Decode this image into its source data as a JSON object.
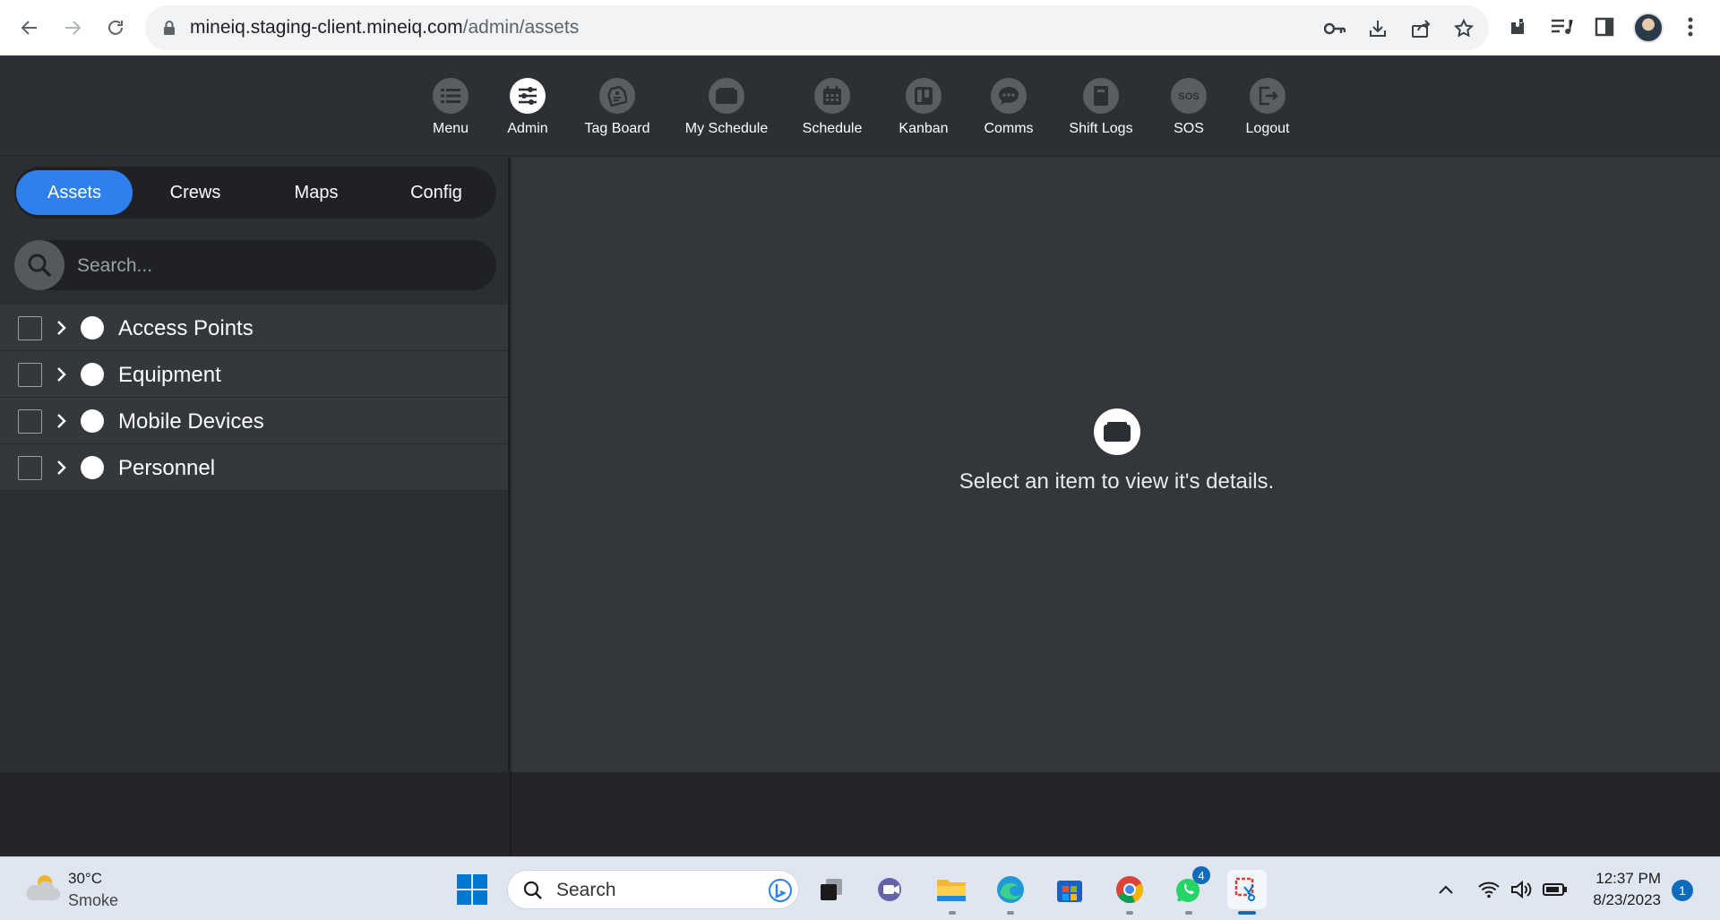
{
  "browser": {
    "url_host": "mineiq.staging-client.mineiq.com",
    "url_path": "/admin/assets"
  },
  "topnav": {
    "items": [
      {
        "label": "Menu",
        "icon": "list-icon"
      },
      {
        "label": "Admin",
        "icon": "sliders-icon",
        "active": true
      },
      {
        "label": "Tag Board",
        "icon": "tag-icon"
      },
      {
        "label": "My Schedule",
        "icon": "folder-icon"
      },
      {
        "label": "Schedule",
        "icon": "calendar-icon"
      },
      {
        "label": "Kanban",
        "icon": "kanban-icon"
      },
      {
        "label": "Comms",
        "icon": "chat-icon"
      },
      {
        "label": "Shift Logs",
        "icon": "book-icon"
      },
      {
        "label": "SOS",
        "icon": "sos-icon"
      },
      {
        "label": "Logout",
        "icon": "logout-icon"
      }
    ]
  },
  "sidebar": {
    "tabs": [
      {
        "label": "Assets",
        "active": true
      },
      {
        "label": "Crews"
      },
      {
        "label": "Maps"
      },
      {
        "label": "Config"
      }
    ],
    "search_placeholder": "Search...",
    "tree": [
      {
        "label": "Access Points"
      },
      {
        "label": "Equipment"
      },
      {
        "label": "Mobile Devices"
      },
      {
        "label": "Personnel"
      }
    ]
  },
  "main": {
    "empty_message": "Select an item to view it's details."
  },
  "taskbar": {
    "weather_temp": "30°C",
    "weather_cond": "Smoke",
    "search_label": "Search",
    "whatsapp_badge": "4",
    "time": "12:37 PM",
    "date": "8/23/2023",
    "notification_count": "1"
  },
  "colors": {
    "accent": "#2f80ed",
    "panel_bg": "#2b2e32",
    "main_bg": "#33363a"
  }
}
